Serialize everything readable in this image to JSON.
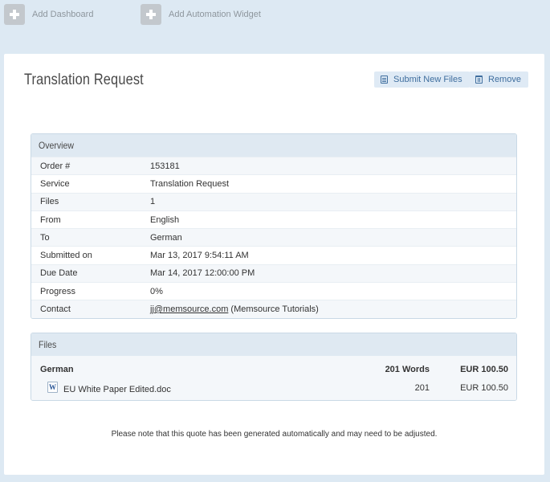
{
  "topbar": {
    "add_dashboard": "Add Dashboard",
    "add_widget": "Add Automation Widget"
  },
  "header": {
    "title": "Translation Request",
    "submit_label": "Submit New Files",
    "remove_label": "Remove"
  },
  "overview": {
    "heading": "Overview",
    "rows": [
      {
        "label": "Order #",
        "value": "153181"
      },
      {
        "label": "Service",
        "value": "Translation Request"
      },
      {
        "label": "Files",
        "value": "1"
      },
      {
        "label": "From",
        "value": "English"
      },
      {
        "label": "To",
        "value": "German"
      },
      {
        "label": "Submitted on",
        "value": "Mar 13, 2017 9:54:11 AM"
      },
      {
        "label": "Due Date",
        "value": "Mar 14, 2017 12:00:00 PM"
      },
      {
        "label": "Progress",
        "value": "0%"
      },
      {
        "label": "Contact",
        "email": "jj@memsource.com",
        "suffix": " (Memsource Tutorials)"
      }
    ]
  },
  "files": {
    "heading": "Files",
    "language": "German",
    "total_words": "201 Words",
    "total_price": "EUR 100.50",
    "items": [
      {
        "name": "EU White Paper Edited.doc",
        "words": "201",
        "price": "EUR 100.50"
      }
    ]
  },
  "note": "Please note that this quote has been generated automatically and may need to be adjusted.",
  "colors": {
    "background": "#dde9f3",
    "accent": "#3f6e9e",
    "header_fill": "#dfe9f2"
  }
}
